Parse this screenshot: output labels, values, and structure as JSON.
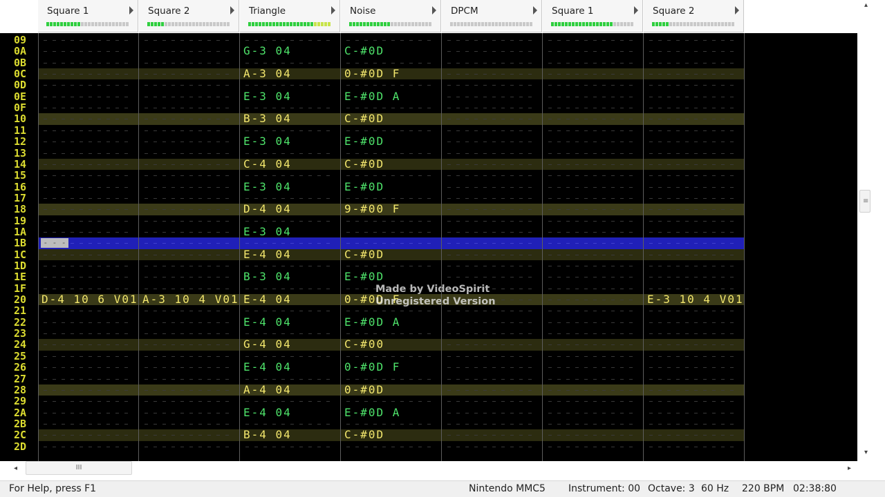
{
  "colors": {
    "row_number": "#dcdc30",
    "row_number_dim": "#a9d642",
    "note_green": "#4fe46b",
    "note_yellow": "#f3e76d",
    "note_orange": "#f39a2b",
    "effect_blue": "#8a8af0",
    "effect_red": "#f05a5a",
    "highlight_row": "#2c2c10",
    "highlight_row_beat": "#3a3a18",
    "cursor_row": "#2020b8"
  },
  "channels": [
    {
      "name": "Square 1",
      "vu_fill": 10
    },
    {
      "name": "Square 2",
      "vu_fill": 5
    },
    {
      "name": "Triangle",
      "vu_fill": 24
    },
    {
      "name": "Noise",
      "vu_fill": 12
    },
    {
      "name": "DPCM",
      "vu_fill": 0
    },
    {
      "name": "Square 1",
      "vu_fill": 18
    },
    {
      "name": "Square 2",
      "vu_fill": 5
    }
  ],
  "rows": [
    {
      "num": "09",
      "cells": [
        "",
        "",
        "",
        "",
        "",
        "",
        ""
      ]
    },
    {
      "num": "0A",
      "cells": [
        "",
        "",
        "G-3 04",
        "C-#0D",
        "",
        "",
        ""
      ]
    },
    {
      "num": "0B",
      "cells": [
        "",
        "",
        "",
        "",
        "",
        "",
        ""
      ]
    },
    {
      "num": "0C",
      "cells": [
        "",
        "",
        "A-3 04",
        "0-#0D F",
        "",
        "",
        ""
      ]
    },
    {
      "num": "0D",
      "cells": [
        "",
        "",
        "",
        "",
        "",
        "",
        ""
      ]
    },
    {
      "num": "0E",
      "cells": [
        "",
        "",
        "E-3 04",
        "E-#0D A",
        "",
        "",
        ""
      ]
    },
    {
      "num": "0F",
      "cells": [
        "",
        "",
        "",
        "",
        "",
        "",
        ""
      ]
    },
    {
      "num": "10",
      "cells": [
        "",
        "",
        "B-3 04",
        "C-#0D",
        "",
        "",
        ""
      ]
    },
    {
      "num": "11",
      "cells": [
        "",
        "",
        "",
        "",
        "",
        "",
        ""
      ]
    },
    {
      "num": "12",
      "cells": [
        "",
        "",
        "E-3 04",
        "E-#0D",
        "",
        "",
        ""
      ]
    },
    {
      "num": "13",
      "cells": [
        "",
        "",
        "",
        "",
        "",
        "",
        ""
      ]
    },
    {
      "num": "14",
      "cells": [
        "",
        "",
        "C-4 04",
        "C-#0D",
        "",
        "",
        ""
      ]
    },
    {
      "num": "15",
      "cells": [
        "",
        "",
        "",
        "",
        "",
        "",
        ""
      ]
    },
    {
      "num": "16",
      "cells": [
        "",
        "",
        "E-3 04",
        "E-#0D",
        "",
        "",
        ""
      ]
    },
    {
      "num": "17",
      "cells": [
        "",
        "",
        "",
        "",
        "",
        "",
        ""
      ]
    },
    {
      "num": "18",
      "cells": [
        "",
        "",
        "D-4 04",
        "9-#00 F",
        "",
        "",
        ""
      ]
    },
    {
      "num": "19",
      "cells": [
        "",
        "",
        "",
        "",
        "",
        "",
        ""
      ]
    },
    {
      "num": "1A",
      "cells": [
        "",
        "",
        "E-3 04",
        "",
        "",
        "",
        ""
      ]
    },
    {
      "num": "1B",
      "cells": [
        "",
        "",
        "",
        "",
        "",
        "",
        ""
      ]
    },
    {
      "num": "1C",
      "cells": [
        "",
        "",
        "E-4 04",
        "C-#0D",
        "",
        "",
        ""
      ]
    },
    {
      "num": "1D",
      "cells": [
        "",
        "",
        "",
        "",
        "",
        "",
        ""
      ]
    },
    {
      "num": "1E",
      "cells": [
        "",
        "",
        "B-3 04",
        "E-#0D",
        "",
        "",
        ""
      ]
    },
    {
      "num": "1F",
      "cells": [
        "",
        "",
        "",
        "",
        "",
        "",
        ""
      ]
    },
    {
      "num": "20",
      "cells": [
        "D-4 10 6 V01",
        "A-3 10 4 V01",
        "E-4 04",
        "0-#0D F",
        "",
        "",
        "E-3 10 4 V01"
      ]
    },
    {
      "num": "21",
      "cells": [
        "",
        "",
        "",
        "",
        "",
        "",
        ""
      ]
    },
    {
      "num": "22",
      "cells": [
        "",
        "",
        "E-4 04",
        "E-#0D A",
        "",
        "",
        ""
      ]
    },
    {
      "num": "23",
      "cells": [
        "",
        "",
        "",
        "",
        "",
        "",
        ""
      ]
    },
    {
      "num": "24",
      "cells": [
        "",
        "",
        "G-4 04",
        "C-#00",
        "",
        "",
        ""
      ]
    },
    {
      "num": "25",
      "cells": [
        "",
        "",
        "",
        "",
        "",
        "",
        ""
      ]
    },
    {
      "num": "26",
      "cells": [
        "",
        "",
        "E-4 04",
        "0-#0D F",
        "",
        "",
        ""
      ]
    },
    {
      "num": "27",
      "cells": [
        "",
        "",
        "",
        "",
        "",
        "",
        ""
      ]
    },
    {
      "num": "28",
      "cells": [
        "",
        "",
        "A-4 04",
        "0-#0D",
        "",
        "",
        ""
      ]
    },
    {
      "num": "29",
      "cells": [
        "",
        "",
        "",
        "",
        "",
        "",
        ""
      ]
    },
    {
      "num": "2A",
      "cells": [
        "",
        "",
        "E-4 04",
        "E-#0D A",
        "",
        "",
        ""
      ]
    },
    {
      "num": "2B",
      "cells": [
        "",
        "",
        "",
        "",
        "",
        "",
        ""
      ]
    },
    {
      "num": "2C",
      "cells": [
        "",
        "",
        "B-4 04",
        "C-#0D",
        "",
        "",
        ""
      ]
    },
    {
      "num": "2D",
      "cells": [
        "",
        "",
        "",
        "",
        "",
        "",
        ""
      ]
    }
  ],
  "cursor_row": "1B",
  "cursor_cell": "- - -",
  "watermark": {
    "line1": "Made by VideoSpirit",
    "line2": "Unregistered Version"
  },
  "scrollbar": {
    "h_thumb_grip": "III"
  },
  "status": {
    "help": "For Help, press F1",
    "chip": "Nintendo MMC5",
    "instrument": "Instrument: 00",
    "octave": "Octave: 3",
    "rate": "60 Hz",
    "bpm": "220 BPM",
    "time": "02:38:80"
  }
}
